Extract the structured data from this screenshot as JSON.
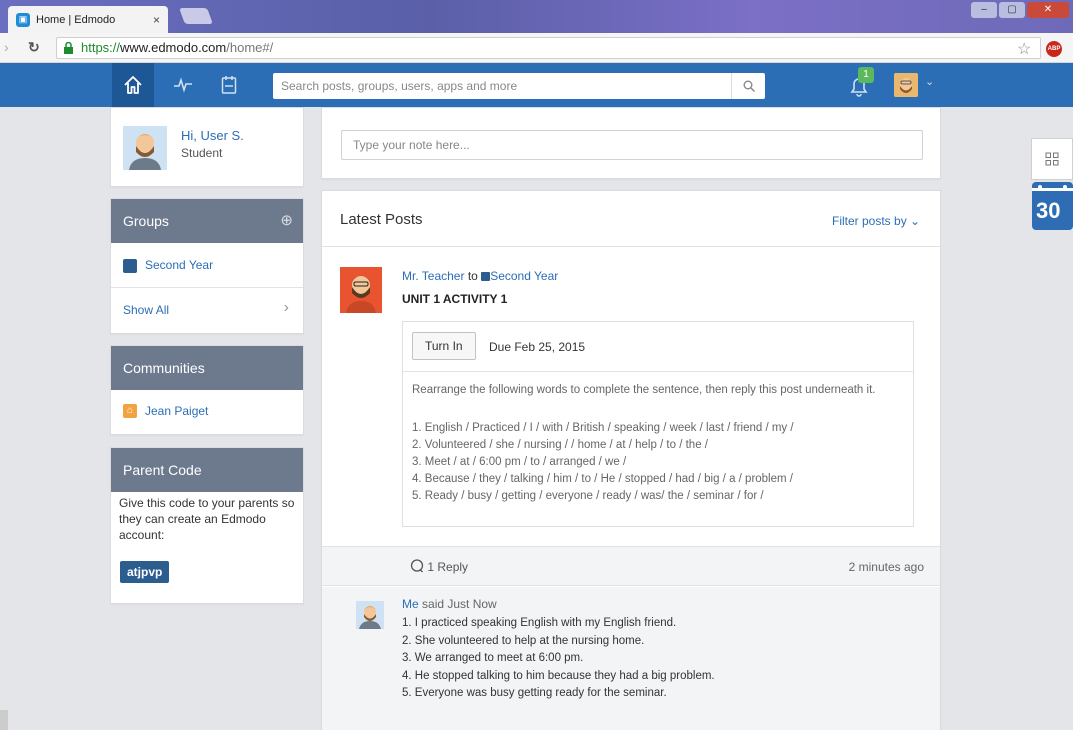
{
  "browser": {
    "tab_title": "Home | Edmodo",
    "tab_close": "×",
    "url_scheme": "https://",
    "url_host": "www.edmodo.com",
    "url_path": "/home#/",
    "ext_abp": "ABP",
    "win_min": "–",
    "win_max": "▢",
    "win_close": "✕"
  },
  "header": {
    "search_placeholder": "Search posts, groups, users, apps and more",
    "notification_count": "1",
    "caret": "⌄",
    "brand_color": "#2c6eb5"
  },
  "profile": {
    "greeting": "Hi, User S.",
    "role": "Student"
  },
  "groups": {
    "title": "Groups",
    "add_icon": "⊕",
    "items": [
      {
        "name": "Second Year",
        "color": "#2c5d8f"
      }
    ],
    "show_all": "Show All",
    "chevron": "›"
  },
  "communities": {
    "title": "Communities",
    "items": [
      {
        "name": "Jean Paiget"
      }
    ]
  },
  "parent_code": {
    "title": "Parent Code",
    "description": "Give this code to your parents so they can create an Edmodo account:",
    "code": "atjpvp"
  },
  "composer": {
    "placeholder": "Type your note here..."
  },
  "feed": {
    "title": "Latest Posts",
    "filter_label": "Filter posts by",
    "filter_caret": "⌄"
  },
  "post": {
    "author": "Mr. Teacher",
    "to_word": "to",
    "group": "Second Year",
    "title": "UNIT 1 ACTIVITY 1",
    "turn_in": "Turn In",
    "due": "Due Feb 25, 2015",
    "instructions": "Rearrange the following words to complete the sentence, then reply this post underneath it.",
    "lines": [
      "1. English / Practiced / I / with / British / speaking / week / last / friend / my /",
      "2. Volunteered / she / nursing / / home / at / help / to / the /",
      "3. Meet / at / 6:00 pm / to / arranged / we /",
      "4. Because / they / talking / him / to / He / stopped / had / big / a / problem /",
      "5. Ready / busy / getting / everyone / ready / was/ the / seminar / for /"
    ],
    "reply_count": "1 Reply",
    "time": "2 minutes ago"
  },
  "reply": {
    "author": "Me",
    "said": "said Just Now",
    "lines": [
      "1. I practiced speaking English with my English friend.",
      "2. She volunteered to help at the nursing home.",
      "3. We arranged to meet at 6:00 pm.",
      "4. He stopped talking to him because they had a big problem.",
      "5. Everyone was busy getting ready for the seminar."
    ]
  },
  "right_rail": {
    "tools_icon": "▫▫",
    "calendar_day": "30"
  }
}
